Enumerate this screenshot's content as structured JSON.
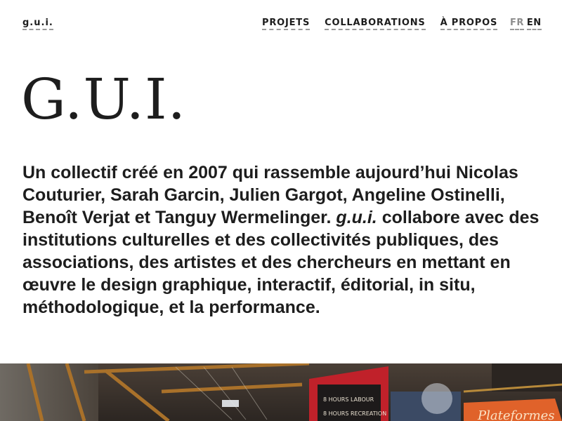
{
  "header": {
    "brand_small": "g.u.i.",
    "nav": [
      {
        "label": "PROJETS"
      },
      {
        "label": "COLLABORATIONS"
      },
      {
        "label": "À PROPOS"
      }
    ],
    "languages": [
      {
        "label": "FR",
        "active": false
      },
      {
        "label": "EN",
        "active": true
      }
    ]
  },
  "hero": {
    "title": "G.U.I."
  },
  "intro": {
    "part1": "Un collectif créé en 2007 qui rassemble aujourd’hui Nicolas Couturier, Sarah Garcin, Julien Gargot, Angeline Ostinelli, Benoît Verjat et Tanguy Wermelinger. ",
    "emphasis": "g.u.i.",
    "part2": " collabore avec des institutions culturelles et des collectivités publiques, des associations, des artistes et des chercheurs en mettant en œuvre le design graphique, interactif, éditorial, in situ, méthodologique, et la performance."
  },
  "photo": {
    "banner_lines": [
      "8 HOURS LABOUR",
      "8 HOURS RECREATION"
    ],
    "sign_text": "Plateformes"
  },
  "colors": {
    "text": "#1d1d1d",
    "muted": "#8e8e8e",
    "underline": "#9a9a9a",
    "banner_red": "#c0212a",
    "banner_orange": "#e0622a"
  }
}
